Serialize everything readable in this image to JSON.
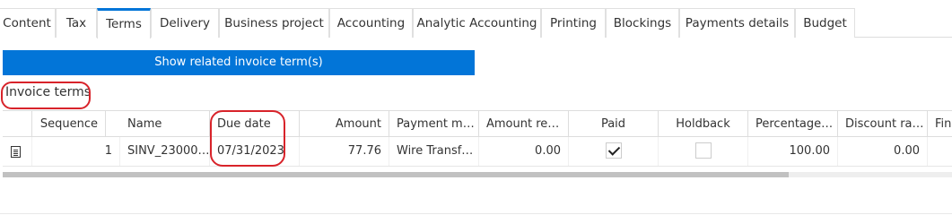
{
  "tabs": [
    {
      "label": "Content",
      "active": false
    },
    {
      "label": "Tax",
      "active": false
    },
    {
      "label": "Terms",
      "active": true
    },
    {
      "label": "Delivery",
      "active": false
    },
    {
      "label": "Business project",
      "active": false
    },
    {
      "label": "Accounting",
      "active": false
    },
    {
      "label": "Analytic Accounting",
      "active": false
    },
    {
      "label": "Printing",
      "active": false
    },
    {
      "label": "Blockings",
      "active": false
    },
    {
      "label": "Payments details",
      "active": false
    },
    {
      "label": "Budget",
      "active": false
    }
  ],
  "related_button_label": "Show related invoice term(s)",
  "section_title": "Invoice terms",
  "grid": {
    "columns": {
      "sequence": "Sequence",
      "name": "Name",
      "due_date": "Due date",
      "amount": "Amount",
      "payment_mode": "Payment m…",
      "amount_remaining": "Amount re…",
      "paid": "Paid",
      "holdback": "Holdback",
      "percentage": "Percentage…",
      "discount_rate": "Discount ra…",
      "financial_discount": "Fin"
    },
    "rows": [
      {
        "icon": "document-icon",
        "sequence": "1",
        "name": "SINV_23000…",
        "due_date": "07/31/2023",
        "amount": "77.76",
        "payment_mode": "Wire Transf…",
        "amount_remaining": "0.00",
        "paid": true,
        "holdback": false,
        "percentage": "100.00",
        "discount_rate": "0.00"
      }
    ]
  },
  "colors": {
    "accent": "#0275d8",
    "highlight_ring": "#d8232a"
  }
}
